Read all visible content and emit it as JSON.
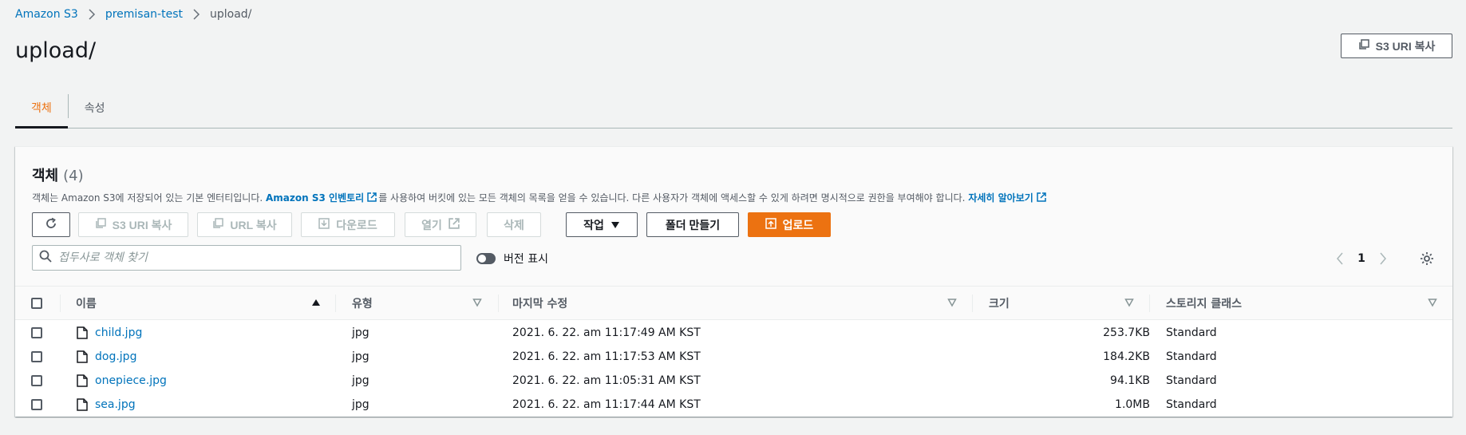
{
  "breadcrumb": {
    "items": [
      "Amazon S3",
      "premisan-test"
    ],
    "current": "upload/"
  },
  "page": {
    "title": "upload/",
    "copy_uri_label": "S3 URI 복사"
  },
  "tabs": [
    {
      "label": "객체",
      "active": true
    },
    {
      "label": "속성",
      "active": false
    }
  ],
  "panel": {
    "title": "객체",
    "count": "(4)",
    "description_prefix": "객체는 Amazon S3에 저장되어 있는 기본 엔터티입니다.",
    "inventory_link": "Amazon S3 인벤토리",
    "description_middle": "를 사용하여 버킷에 있는 모든 객체의 목록을 얻을 수 있습니다. 다른 사용자가 객체에 액세스할 수 있게 하려면 명시적으로 권한을 부여해야 합니다.",
    "learn_more": "자세히 알아보기"
  },
  "toolbar": {
    "copy_s3_uri": "S3 URI 복사",
    "copy_url": "URL 복사",
    "download": "다운로드",
    "open": "열기",
    "delete": "삭제",
    "actions": "작업",
    "create_folder": "폴더 만들기",
    "upload": "업로드"
  },
  "search": {
    "placeholder": "접두사로 객체 찾기",
    "value": ""
  },
  "versions_toggle": {
    "label": "버전 표시",
    "on": false
  },
  "pagination": {
    "current_page": "1"
  },
  "table": {
    "columns": {
      "name": "이름",
      "type": "유형",
      "modified": "마지막 수정",
      "size": "크기",
      "storage": "스토리지 클래스"
    },
    "rows": [
      {
        "name": "child.jpg",
        "type": "jpg",
        "modified": "2021. 6. 22. am 11:17:49 AM KST",
        "size": "253.7KB",
        "storage": "Standard"
      },
      {
        "name": "dog.jpg",
        "type": "jpg",
        "modified": "2021. 6. 22. am 11:17:53 AM KST",
        "size": "184.2KB",
        "storage": "Standard"
      },
      {
        "name": "onepiece.jpg",
        "type": "jpg",
        "modified": "2021. 6. 22. am 11:05:31 AM KST",
        "size": "94.1KB",
        "storage": "Standard"
      },
      {
        "name": "sea.jpg",
        "type": "jpg",
        "modified": "2021. 6. 22. am 11:17:44 AM KST",
        "size": "1.0MB",
        "storage": "Standard"
      }
    ]
  },
  "colors": {
    "accent": "#ec7211",
    "link": "#0073bb",
    "text": "#16191f",
    "muted": "#545b64"
  }
}
